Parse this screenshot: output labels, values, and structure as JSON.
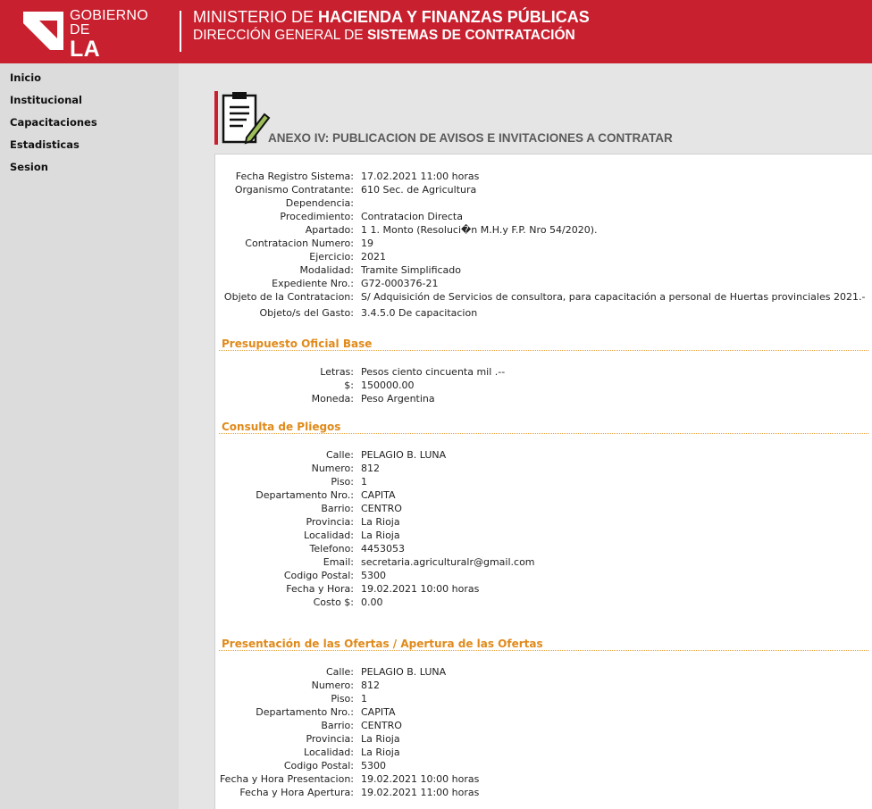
{
  "header": {
    "logo_line1": "GOBIERNO DE",
    "logo_line2": "LA RIOJA",
    "title1_light": "MINISTERIO DE ",
    "title1_bold": "HACIENDA Y FINANZAS PÚBLICAS",
    "title2_light": "DIRECCIÓN GENERAL DE ",
    "title2_bold": "SISTEMAS DE CONTRATACIÓN"
  },
  "sidebar": {
    "items": [
      {
        "label": "Inicio"
      },
      {
        "label": "Institucional"
      },
      {
        "label": "Capacitaciones"
      },
      {
        "label": "Estadisticas"
      },
      {
        "label": "Sesion"
      }
    ]
  },
  "page": {
    "title": "ANEXO IV: PUBLICACION DE AVISOS E INVITACIONES A CONTRATAR",
    "icon": "document-pencil-icon"
  },
  "general": [
    {
      "label": "Fecha Registro Sistema:",
      "value": "17.02.2021 11:00 horas"
    },
    {
      "label": "Organismo Contratante:",
      "value": "610 Sec. de Agricultura"
    },
    {
      "label": "Dependencia:",
      "value": ""
    },
    {
      "label": "Procedimiento:",
      "value": "Contratacion Directa"
    },
    {
      "label": "Apartado:",
      "value": "1 1. Monto (Resoluci�n M.H.y F.P. Nro 54/2020)."
    },
    {
      "label": "Contratacion Numero:",
      "value": "19"
    },
    {
      "label": "Ejercicio:",
      "value": "2021"
    },
    {
      "label": "Modalidad:",
      "value": "Tramite Simplificado"
    },
    {
      "label": "Expediente Nro.:",
      "value": "G72-000376-21"
    },
    {
      "label": "Objeto de la Contratacion:",
      "value": "S/ Adquisición de Servicios de consultora, para capacitación a personal de Huertas provinciales 2021.-"
    },
    {
      "label": "Objeto/s del Gasto:",
      "value": " 3.4.5.0 De capacitacion"
    }
  ],
  "presupuesto": {
    "title": "Presupuesto Oficial Base",
    "rows": [
      {
        "label": "Letras:",
        "value": "Pesos ciento cincuenta mil .--"
      },
      {
        "label": "$:",
        "value": "150000.00"
      },
      {
        "label": "Moneda:",
        "value": "Peso Argentina"
      }
    ]
  },
  "pliegos": {
    "title": "Consulta de Pliegos",
    "rows": [
      {
        "label": "Calle:",
        "value": "PELAGIO B. LUNA"
      },
      {
        "label": "Numero:",
        "value": "812"
      },
      {
        "label": "Piso:",
        "value": "1"
      },
      {
        "label": "Departamento Nro.:",
        "value": "CAPITA"
      },
      {
        "label": "Barrio:",
        "value": "CENTRO"
      },
      {
        "label": "Provincia:",
        "value": "La Rioja"
      },
      {
        "label": "Localidad:",
        "value": "La Rioja"
      },
      {
        "label": "Telefono:",
        "value": "4453053"
      },
      {
        "label": "Email:",
        "value": "secretaria.agriculturalr@gmail.com"
      },
      {
        "label": "Codigo Postal:",
        "value": "5300"
      },
      {
        "label": "Fecha y Hora:",
        "value": "19.02.2021 10:00 horas"
      },
      {
        "label": "Costo $:",
        "value": "0.00"
      }
    ]
  },
  "ofertas": {
    "title": "Presentación de las Ofertas / Apertura de las Ofertas",
    "rows": [
      {
        "label": "Calle:",
        "value": "PELAGIO B. LUNA"
      },
      {
        "label": "Numero:",
        "value": "812"
      },
      {
        "label": "Piso:",
        "value": "1"
      },
      {
        "label": "Departamento Nro.:",
        "value": "CAPITA"
      },
      {
        "label": "Barrio:",
        "value": "CENTRO"
      },
      {
        "label": "Provincia:",
        "value": "La Rioja"
      },
      {
        "label": "Localidad:",
        "value": "La Rioja"
      },
      {
        "label": "Codigo Postal:",
        "value": "5300"
      },
      {
        "label": "Fecha y Hora Presentacion:",
        "value": "19.02.2021 10:00 horas"
      },
      {
        "label": "Fecha y Hora Apertura:",
        "value": "19.02.2021 11:00 horas"
      }
    ]
  },
  "colors": {
    "brand_red": "#c8202f",
    "section_orange": "#e08a1a"
  }
}
